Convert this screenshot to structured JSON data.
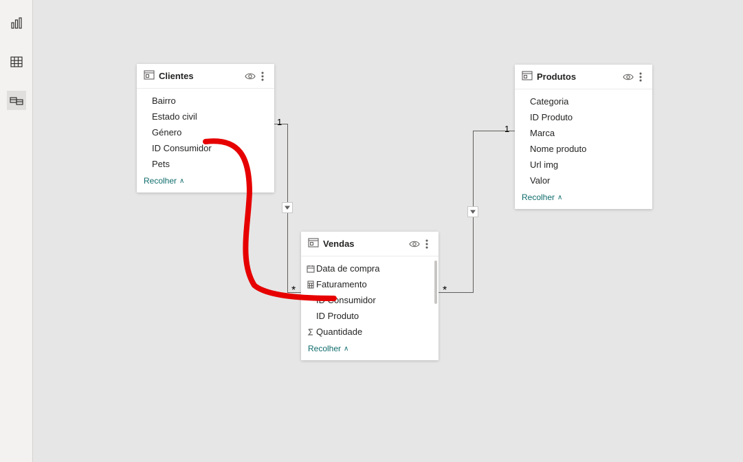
{
  "nav": {
    "report": "Report view",
    "data": "Data view",
    "model": "Model view"
  },
  "collapse_label": "Recolher",
  "tables": {
    "clientes": {
      "title": "Clientes",
      "fields": {
        "f0": "Bairro",
        "f1": "Estado civil",
        "f2": "Género",
        "f3": "ID Consumidor",
        "f4": "Pets"
      }
    },
    "vendas": {
      "title": "Vendas",
      "fields": {
        "f0": "Data de compra",
        "f1": "Faturamento",
        "f2": "ID Consumidor",
        "f3": "ID Produto",
        "f4": "Quantidade"
      }
    },
    "produtos": {
      "title": "Produtos",
      "fields": {
        "f0": "Categoria",
        "f1": "ID Produto",
        "f2": "Marca",
        "f3": "Nome produto",
        "f4": "Url img",
        "f5": "Valor"
      }
    }
  },
  "relationships": {
    "r1": {
      "one": "1",
      "many": "*"
    },
    "r2": {
      "one": "1",
      "many": "*"
    }
  }
}
